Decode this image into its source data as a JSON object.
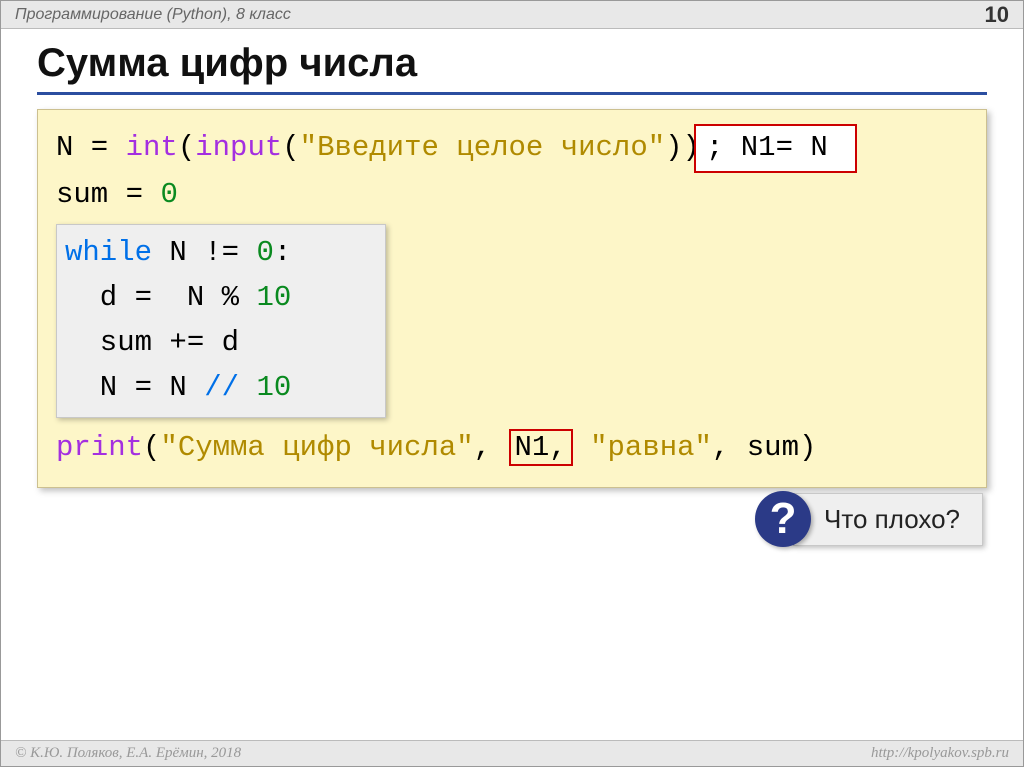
{
  "header": {
    "course": "Программирование (Python), 8 класс",
    "page_number": "10"
  },
  "title": "Сумма цифр числа",
  "code": {
    "line1": {
      "lhs": "N",
      "eq": " = ",
      "fn_int": "int",
      "paren1": "(",
      "fn_input": "input",
      "paren2": "(",
      "str": "\"Введите целое число\"",
      "paren3": "))",
      "semi": ";",
      "n1_box": " N1= N "
    },
    "line2": {
      "text_lhs": "sum",
      "eq": " = ",
      "num": "0"
    },
    "inner": {
      "l1": {
        "kw": "while",
        "rest": " N != ",
        "num": "0",
        "colon": ":"
      },
      "l2": {
        "indent": "  d = ",
        "mid": " N % ",
        "num": "10"
      },
      "l3": {
        "text": "  sum += d"
      },
      "l4": {
        "indent": "  N = N ",
        "op": "//",
        "sp": " ",
        "num": "10"
      }
    },
    "line_print": {
      "fn": "print",
      "paren1": "(",
      "str1": "\"Сумма цифр числа\"",
      "comma1": ", ",
      "n1": "N1,",
      "sp": " ",
      "str2": "\"равна\"",
      "comma2": ", sum)",
      "tail": ""
    }
  },
  "callout": {
    "badge": "?",
    "text": "Что плохо?"
  },
  "footer": {
    "left": "© К.Ю. Поляков, Е.А. Ерёмин, 2018",
    "right": "http://kpolyakov.spb.ru"
  }
}
